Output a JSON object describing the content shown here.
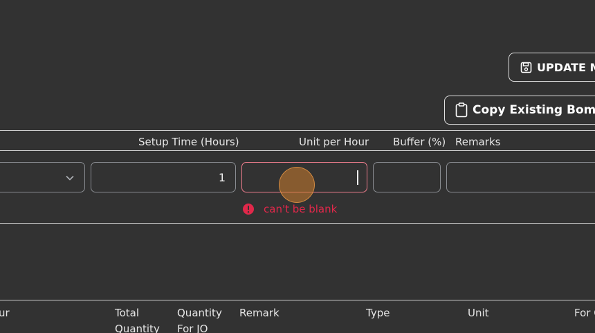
{
  "toolbar": {
    "update_label": "UPDATE MA",
    "copy_label": "Copy Existing Bom"
  },
  "form": {
    "headers": {
      "setup_time": "Setup Time (Hours)",
      "unit_per_hour": "Unit per Hour",
      "buffer": "Buffer (%)",
      "remarks": "Remarks"
    },
    "setup_time_value": "1",
    "unit_per_hour_value": "",
    "buffer_value": "",
    "remarks_value": "",
    "unit_per_hour_error": "can't be blank"
  },
  "table": {
    "headers": {
      "col_partial": "ur",
      "total_quantity_line1": "Total",
      "total_quantity_line2": "Quantity",
      "quantity_for_jo_line1": "Quantity",
      "quantity_for_jo_line2": "For JO",
      "remark": "Remark",
      "type": "Type",
      "unit": "Unit",
      "for_partial": "For C"
    }
  },
  "colors": {
    "background": "#323232",
    "error": "#e0284a",
    "error_border": "#f07e8e"
  },
  "icons": [
    "save-icon",
    "clipboard-icon",
    "chevron-down-icon",
    "error-icon"
  ]
}
